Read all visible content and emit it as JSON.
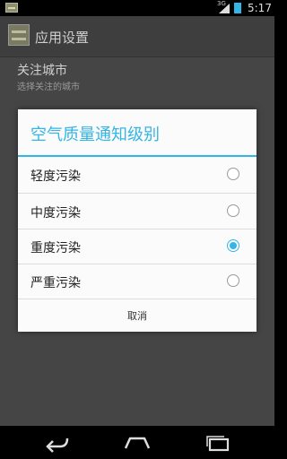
{
  "status_bar": {
    "network": "3G",
    "time": "5:17",
    "accent_color": "#33b5e5"
  },
  "app": {
    "title": "应用设置",
    "icon": "app-icon"
  },
  "preferences": [
    {
      "title": "关注城市",
      "summary": "选择关注的城市"
    },
    {
      "title": "",
      "summary": ""
    },
    {
      "title": "",
      "summary": ""
    }
  ],
  "dialog": {
    "title": "空气质量通知级别",
    "accent_color": "#33b5e5",
    "options": [
      {
        "label": "轻度污染",
        "selected": false
      },
      {
        "label": "中度污染",
        "selected": false
      },
      {
        "label": "重度污染",
        "selected": true
      },
      {
        "label": "严重污染",
        "selected": false
      }
    ],
    "cancel_label": "取消"
  },
  "nav_bar": {
    "buttons": [
      "back-icon",
      "home-icon",
      "recents-icon"
    ]
  }
}
